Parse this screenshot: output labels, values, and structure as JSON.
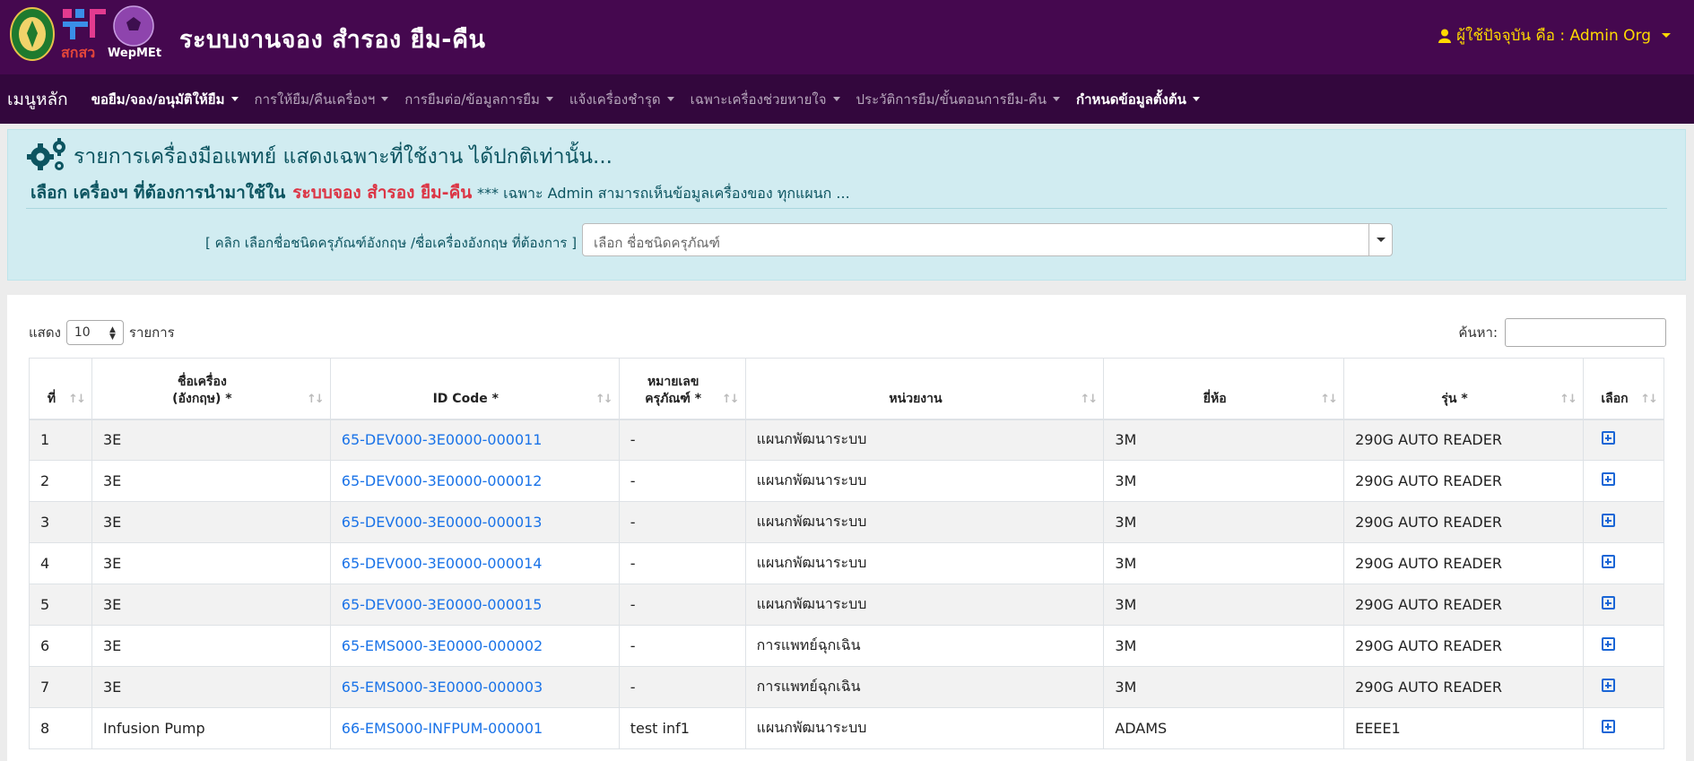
{
  "header": {
    "logo_caption": "สกสว",
    "brand_caption": "WepMEt",
    "title": "ระบบงานจอง สำรอง ยืม-คืน",
    "user_label": "ผู้ใช้ปัจจุบัน คือ : Admin Org"
  },
  "menu": {
    "home": "เมนูหลัก",
    "items": [
      {
        "label": "ขอยืม/จอง/อนุมัติให้ยืม",
        "active": true
      },
      {
        "label": "การให้ยืม/คืนเครื่องฯ",
        "active": false
      },
      {
        "label": "การยืมต่อ/ข้อมูลการยืม",
        "active": false
      },
      {
        "label": "แจ้งเครื่องชำรุด",
        "active": false
      },
      {
        "label": "เฉพาะเครื่องช่วยหายใจ",
        "active": false
      },
      {
        "label": "ประวัติการยืม/ขั้นตอนการยืม-คืน",
        "active": false
      },
      {
        "label": "กำหนดข้อมูลตั้งต้น",
        "active": true
      }
    ]
  },
  "info": {
    "heading": "รายการเครื่องมือแพทย์ แสดงเฉพาะที่ใช้งาน ได้ปกติเท่านั้น...",
    "select_prefix": "เลือก เครื่องฯ ที่ต้องการนำมาใช้ใน",
    "select_system": "ระบบจอง สำรอง ยืม-คืน",
    "admin_note": "*** เฉพาะ Admin สามารถเห็นข้อมูลเครื่องของ ทุกแผนก ...",
    "pick_label": "[ คลิก เลือกชื่อชนิดครุภัณฑ์อังกฤษ /ชื่อเครื่องอังกฤษ ที่ต้องการ ] :",
    "pick_placeholder": "เลือก ชื่อชนิดครุภัณฑ์"
  },
  "table": {
    "show_label": "แสดง",
    "page_length": "10",
    "entries_label": "รายการ",
    "search_label": "ค้นหา:",
    "columns": [
      {
        "line1": "ที่",
        "line2": ""
      },
      {
        "line1": "ชื่อเครื่อง",
        "line2": "(อังกฤษ) *"
      },
      {
        "line1": "ID Code *",
        "line2": ""
      },
      {
        "line1": "หมายเลข",
        "line2": "ครุภัณฑ์ *"
      },
      {
        "line1": "หน่วยงาน",
        "line2": ""
      },
      {
        "line1": "ยี่ห้อ",
        "line2": ""
      },
      {
        "line1": "รุ่น *",
        "line2": ""
      },
      {
        "line1": "เลือก",
        "line2": ""
      }
    ],
    "rows": [
      {
        "no": "1",
        "name": "3E",
        "id_code": "65-DEV000-3E0000-000011",
        "asset_no": "-",
        "unit": "แผนกพัฒนาระบบ",
        "brand": "3M",
        "model": "290G AUTO READER"
      },
      {
        "no": "2",
        "name": "3E",
        "id_code": "65-DEV000-3E0000-000012",
        "asset_no": "-",
        "unit": "แผนกพัฒนาระบบ",
        "brand": "3M",
        "model": "290G AUTO READER"
      },
      {
        "no": "3",
        "name": "3E",
        "id_code": "65-DEV000-3E0000-000013",
        "asset_no": "-",
        "unit": "แผนกพัฒนาระบบ",
        "brand": "3M",
        "model": "290G AUTO READER"
      },
      {
        "no": "4",
        "name": "3E",
        "id_code": "65-DEV000-3E0000-000014",
        "asset_no": "-",
        "unit": "แผนกพัฒนาระบบ",
        "brand": "3M",
        "model": "290G AUTO READER"
      },
      {
        "no": "5",
        "name": "3E",
        "id_code": "65-DEV000-3E0000-000015",
        "asset_no": "-",
        "unit": "แผนกพัฒนาระบบ",
        "brand": "3M",
        "model": "290G AUTO READER"
      },
      {
        "no": "6",
        "name": "3E",
        "id_code": "65-EMS000-3E0000-000002",
        "asset_no": "-",
        "unit": "การแพทย์ฉุกเฉิน",
        "brand": "3M",
        "model": "290G AUTO READER"
      },
      {
        "no": "7",
        "name": "3E",
        "id_code": "65-EMS000-3E0000-000003",
        "asset_no": "-",
        "unit": "การแพทย์ฉุกเฉิน",
        "brand": "3M",
        "model": "290G AUTO READER"
      },
      {
        "no": "8",
        "name": "Infusion Pump",
        "id_code": "66-EMS000-INFPUM-000001",
        "asset_no": "test inf1",
        "unit": "แผนกพัฒนาระบบ",
        "brand": "ADAMS",
        "model": "EEEE1"
      }
    ]
  },
  "colors": {
    "header_bg": "#45084f",
    "menu_bg": "#33073d",
    "user_text": "#ffd900",
    "info_bg": "#d1ecf1",
    "link": "#1a73e8",
    "accent_red": "#dc3545"
  }
}
